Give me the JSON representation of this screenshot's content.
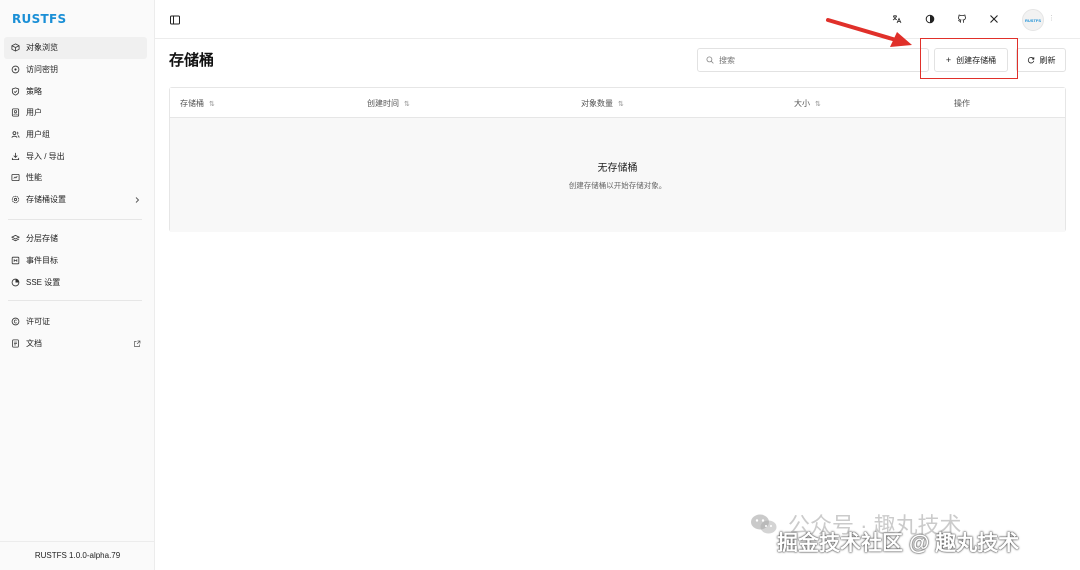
{
  "app": {
    "logo": "RUSTFS",
    "version": "RUSTFS 1.0.0-alpha.79"
  },
  "sidebar": {
    "group1": [
      {
        "label": "对象浏览",
        "icon": "box-icon",
        "active": true
      },
      {
        "label": "访问密钥",
        "icon": "key-icon"
      },
      {
        "label": "策略",
        "icon": "shield-icon"
      },
      {
        "label": "用户",
        "icon": "user-icon"
      },
      {
        "label": "用户组",
        "icon": "users-icon"
      },
      {
        "label": "导入 / 导出",
        "icon": "download-icon"
      },
      {
        "label": "性能",
        "icon": "gauge-icon"
      },
      {
        "label": "存储桶设置",
        "icon": "settings-icon",
        "trail": "chevron-right-icon"
      }
    ],
    "group2": [
      {
        "label": "分层存储",
        "icon": "layers-icon"
      },
      {
        "label": "事件目标",
        "icon": "target-icon"
      },
      {
        "label": "SSE 设置",
        "icon": "lock-icon"
      }
    ],
    "group3": [
      {
        "label": "许可证",
        "icon": "copyright-icon"
      },
      {
        "label": "文档",
        "icon": "doc-icon",
        "trail": "external-link-icon"
      }
    ]
  },
  "topbar": {
    "icons": [
      "sidebar-toggle-icon",
      "translate-icon",
      "theme-icon",
      "github-icon",
      "x-icon"
    ],
    "avatar_text": "RUSTFS",
    "avatar_more": "⋮"
  },
  "page": {
    "title": "存储桶",
    "search_placeholder": "搜索",
    "create_button": "创建存储桶",
    "create_glyph": "+",
    "refresh_button": "刷新"
  },
  "table": {
    "columns": [
      {
        "label": "存储桶",
        "sortable": true
      },
      {
        "label": "创建时间",
        "sortable": true
      },
      {
        "label": "对象数量",
        "sortable": true
      },
      {
        "label": "大小",
        "sortable": true
      },
      {
        "label": "操作",
        "sortable": false
      }
    ],
    "sort_glyph": "⇅",
    "empty_title": "无存储桶",
    "empty_subtitle": "创建存储桶以开始存储对象。"
  },
  "watermark": {
    "line1": "公众号 · 趣丸技术",
    "line2": "掘金技术社区 @ 趣丸技术"
  },
  "colors": {
    "brand": "#1a8fd6",
    "highlight": "#e0302a"
  }
}
